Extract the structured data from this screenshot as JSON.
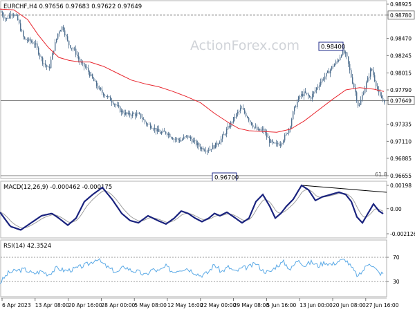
{
  "watermark": "ActionForex.com",
  "colors": {
    "candle": "#4f6f8f",
    "ma": "#e8262e",
    "macd": "#1a237e",
    "signal": "#9e9e9e",
    "rsi": "#5aa9e6",
    "box_fill": "#ffffff",
    "box_stroke": "#1f2b8a"
  },
  "main": {
    "header": "EURCHF,H4  0.97656  0.97683  0.97622  0.97649",
    "y_ticks": [
      "0.98925",
      "0.98780",
      "0.98470",
      "0.98245",
      "0.98015",
      "0.97790",
      "0.97649",
      "0.97335",
      "0.97110",
      "0.96885",
      "0.96655"
    ],
    "annotations": {
      "high": "0.98400",
      "low": "0.96700",
      "fib": "61.8"
    }
  },
  "macd": {
    "header": "MACD(12,26,9) -0.000462 -0.000175",
    "y_ticks": [
      "0.00198",
      "0.00",
      "-0.002126"
    ]
  },
  "rsi": {
    "header": "RSI(14) 42.3524",
    "y_ticks": [
      "70",
      "30"
    ]
  },
  "x_labels": [
    "6 Apr 2023",
    "13 Apr 08:00",
    "20 Apr 16:00",
    "28 Apr 00:00",
    "5 May 08:00",
    "12 May 16:00",
    "22 May 00:00",
    "29 May 08:00",
    "5 Jun 16:00",
    "13 Jun 00:00",
    "20 Jun 08:00",
    "27 Jun 16:00"
  ],
  "chart_data": {
    "type": "candlestick",
    "symbol": "EURCHF",
    "timeframe": "H4",
    "ylim": [
      0.96655,
      0.98925
    ],
    "hlines": [
      0.9878,
      0.97649,
      0.96655
    ],
    "price_anchors": [
      [
        0,
        0.9883
      ],
      [
        8,
        0.9872
      ],
      [
        16,
        0.9882
      ],
      [
        24,
        0.9874
      ],
      [
        34,
        0.9846
      ],
      [
        42,
        0.9844
      ],
      [
        50,
        0.984
      ],
      [
        60,
        0.9818
      ],
      [
        70,
        0.9806
      ],
      [
        76,
        0.983
      ],
      [
        84,
        0.9857
      ],
      [
        90,
        0.9863
      ],
      [
        98,
        0.984
      ],
      [
        108,
        0.983
      ],
      [
        116,
        0.9814
      ],
      [
        124,
        0.9808
      ],
      [
        134,
        0.9792
      ],
      [
        144,
        0.9778
      ],
      [
        154,
        0.977
      ],
      [
        164,
        0.9762
      ],
      [
        174,
        0.9751
      ],
      [
        184,
        0.9746
      ],
      [
        194,
        0.9747
      ],
      [
        202,
        0.9745
      ],
      [
        210,
        0.9735
      ],
      [
        220,
        0.973
      ],
      [
        230,
        0.9722
      ],
      [
        240,
        0.9723
      ],
      [
        250,
        0.9715
      ],
      [
        260,
        0.9712
      ],
      [
        270,
        0.9718
      ],
      [
        280,
        0.971
      ],
      [
        290,
        0.9702
      ],
      [
        300,
        0.97
      ],
      [
        310,
        0.9705
      ],
      [
        320,
        0.9715
      ],
      [
        330,
        0.973
      ],
      [
        340,
        0.9745
      ],
      [
        348,
        0.9755
      ],
      [
        356,
        0.9745
      ],
      [
        364,
        0.9733
      ],
      [
        372,
        0.9725
      ],
      [
        380,
        0.9726
      ],
      [
        388,
        0.9712
      ],
      [
        396,
        0.9706
      ],
      [
        404,
        0.9708
      ],
      [
        412,
        0.9718
      ],
      [
        418,
        0.973
      ],
      [
        424,
        0.9752
      ],
      [
        432,
        0.977
      ],
      [
        440,
        0.9775
      ],
      [
        448,
        0.9768
      ],
      [
        456,
        0.978
      ],
      [
        464,
        0.9792
      ],
      [
        472,
        0.98
      ],
      [
        480,
        0.981
      ],
      [
        488,
        0.9818
      ],
      [
        494,
        0.983
      ],
      [
        500,
        0.9825
      ],
      [
        506,
        0.98
      ],
      [
        512,
        0.978
      ],
      [
        518,
        0.9755
      ],
      [
        524,
        0.9775
      ],
      [
        530,
        0.979
      ],
      [
        536,
        0.9808
      ],
      [
        542,
        0.979
      ],
      [
        548,
        0.977
      ],
      [
        555,
        0.97649
      ]
    ],
    "ma_anchors": [
      [
        0,
        0.9886
      ],
      [
        20,
        0.9885
      ],
      [
        40,
        0.9872
      ],
      [
        55,
        0.9852
      ],
      [
        70,
        0.9835
      ],
      [
        85,
        0.9822
      ],
      [
        100,
        0.9818
      ],
      [
        115,
        0.9816
      ],
      [
        130,
        0.9816
      ],
      [
        150,
        0.981
      ],
      [
        170,
        0.9801
      ],
      [
        190,
        0.9792
      ],
      [
        210,
        0.9787
      ],
      [
        230,
        0.9783
      ],
      [
        250,
        0.9777
      ],
      [
        270,
        0.977
      ],
      [
        290,
        0.9762
      ],
      [
        310,
        0.9748
      ],
      [
        330,
        0.9736
      ],
      [
        345,
        0.9728
      ],
      [
        360,
        0.9725
      ],
      [
        380,
        0.9724
      ],
      [
        400,
        0.9723
      ],
      [
        420,
        0.9727
      ],
      [
        440,
        0.9738
      ],
      [
        460,
        0.9752
      ],
      [
        480,
        0.9766
      ],
      [
        500,
        0.9779
      ],
      [
        520,
        0.9782
      ],
      [
        540,
        0.978
      ],
      [
        555,
        0.9777
      ]
    ],
    "macd_anchors": [
      [
        0,
        -0.0003
      ],
      [
        15,
        -0.0015
      ],
      [
        30,
        -0.0018
      ],
      [
        45,
        -0.0012
      ],
      [
        60,
        -0.0006
      ],
      [
        75,
        -0.0004
      ],
      [
        85,
        -0.0008
      ],
      [
        98,
        -0.0014
      ],
      [
        110,
        -0.0008
      ],
      [
        122,
        0.0006
      ],
      [
        134,
        0.0012
      ],
      [
        148,
        0.0018
      ],
      [
        162,
        0.0008
      ],
      [
        176,
        -0.0004
      ],
      [
        188,
        -0.001
      ],
      [
        200,
        -0.0012
      ],
      [
        214,
        -0.0006
      ],
      [
        228,
        -0.001
      ],
      [
        240,
        -0.0013
      ],
      [
        252,
        -0.0008
      ],
      [
        262,
        -0.0002
      ],
      [
        272,
        -0.0004
      ],
      [
        282,
        -0.0008
      ],
      [
        292,
        -0.0011
      ],
      [
        302,
        -0.0008
      ],
      [
        310,
        -0.0004
      ],
      [
        318,
        -0.0006
      ],
      [
        328,
        -0.0003
      ],
      [
        338,
        -0.0007
      ],
      [
        350,
        -0.0012
      ],
      [
        360,
        -0.0008
      ],
      [
        370,
        0.0006
      ],
      [
        380,
        0.0012
      ],
      [
        390,
        0.0002
      ],
      [
        398,
        -0.0008
      ],
      [
        406,
        -0.0004
      ],
      [
        414,
        0.0002
      ],
      [
        424,
        0.0008
      ],
      [
        436,
        0.00198
      ],
      [
        446,
        0.0016
      ],
      [
        456,
        0.0007
      ],
      [
        466,
        0.001
      ],
      [
        478,
        0.0012
      ],
      [
        490,
        0.0014
      ],
      [
        500,
        0.0012
      ],
      [
        508,
        0.0006
      ],
      [
        516,
        -0.0007
      ],
      [
        524,
        -0.0012
      ],
      [
        532,
        -0.0004
      ],
      [
        540,
        0.0004
      ],
      [
        548,
        -0.0002
      ],
      [
        555,
        -0.00046
      ]
    ],
    "rsi_anchors": [
      [
        0,
        28
      ],
      [
        12,
        44
      ],
      [
        24,
        48
      ],
      [
        36,
        50
      ],
      [
        48,
        43
      ],
      [
        60,
        47
      ],
      [
        70,
        42
      ],
      [
        82,
        52
      ],
      [
        94,
        48
      ],
      [
        106,
        50
      ],
      [
        118,
        55
      ],
      [
        130,
        60
      ],
      [
        140,
        68
      ],
      [
        150,
        58
      ],
      [
        160,
        50
      ],
      [
        170,
        45
      ],
      [
        180,
        55
      ],
      [
        190,
        48
      ],
      [
        200,
        46
      ],
      [
        210,
        40
      ],
      [
        220,
        50
      ],
      [
        230,
        47
      ],
      [
        240,
        55
      ],
      [
        250,
        46
      ],
      [
        260,
        50
      ],
      [
        270,
        52
      ],
      [
        280,
        46
      ],
      [
        290,
        40
      ],
      [
        300,
        44
      ],
      [
        310,
        58
      ],
      [
        320,
        46
      ],
      [
        330,
        54
      ],
      [
        340,
        46
      ],
      [
        350,
        52
      ],
      [
        360,
        54
      ],
      [
        370,
        60
      ],
      [
        380,
        48
      ],
      [
        390,
        45
      ],
      [
        400,
        56
      ],
      [
        410,
        62
      ],
      [
        420,
        50
      ],
      [
        432,
        67
      ],
      [
        440,
        56
      ],
      [
        450,
        62
      ],
      [
        460,
        56
      ],
      [
        470,
        62
      ],
      [
        480,
        58
      ],
      [
        490,
        64
      ],
      [
        500,
        66
      ],
      [
        510,
        50
      ],
      [
        518,
        38
      ],
      [
        526,
        50
      ],
      [
        534,
        62
      ],
      [
        540,
        54
      ],
      [
        548,
        44
      ],
      [
        555,
        42.35
      ]
    ],
    "rsi_ylim": [
      0,
      100
    ]
  }
}
